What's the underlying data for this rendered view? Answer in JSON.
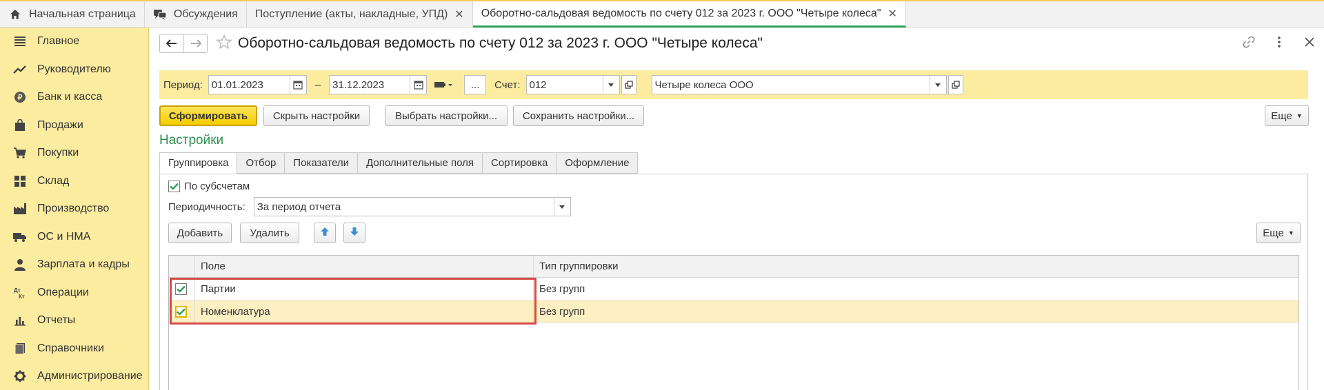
{
  "top_tabs": [
    {
      "label": "Начальная страница",
      "icon": "home-icon"
    },
    {
      "label": "Обсуждения",
      "icon": "chat-icon"
    },
    {
      "label": "Поступление (акты, накладные, УПД)",
      "closable": true
    },
    {
      "label": "Оборотно-сальдовая ведомость по счету 012 за 2023 г. ООО \"Четыре колеса\"",
      "closable": true,
      "active": true
    }
  ],
  "sidebar": {
    "items": [
      {
        "label": "Главное",
        "icon": "menu-icon"
      },
      {
        "label": "Руководителю",
        "icon": "trend-icon"
      },
      {
        "label": "Банк и касса",
        "icon": "coin-icon"
      },
      {
        "label": "Продажи",
        "icon": "bag-icon"
      },
      {
        "label": "Покупки",
        "icon": "cart-icon"
      },
      {
        "label": "Склад",
        "icon": "warehouse-icon"
      },
      {
        "label": "Производство",
        "icon": "factory-icon"
      },
      {
        "label": "ОС и НМА",
        "icon": "truck-icon"
      },
      {
        "label": "Зарплата и кадры",
        "icon": "person-icon"
      },
      {
        "label": "Операции",
        "icon": "dt-kt-icon"
      },
      {
        "label": "Отчеты",
        "icon": "bar-chart-icon"
      },
      {
        "label": "Справочники",
        "icon": "book-icon"
      },
      {
        "label": "Администрирование",
        "icon": "gear-icon"
      }
    ],
    "dt_kt_text": {
      "dt": "Дт",
      "kt": "Кт"
    }
  },
  "header": {
    "title": "Оборотно-сальдовая ведомость по счету 012 за 2023 г. ООО \"Четыре колеса\""
  },
  "period_bar": {
    "period_label": "Период:",
    "date_from": "01.01.2023",
    "dash": "–",
    "date_to": "31.12.2023",
    "more_label": "...",
    "account_label": "Счет:",
    "account_value": "012",
    "organization_value": "Четыре колеса ООО"
  },
  "toolbar": {
    "generate_label": "Сформировать",
    "hide_settings_label": "Скрыть настройки",
    "choose_settings_label": "Выбрать настройки...",
    "save_settings_label": "Сохранить настройки...",
    "more_label": "Еще"
  },
  "settings": {
    "title": "Настройки",
    "tabs": [
      "Группировка",
      "Отбор",
      "Показатели",
      "Дополнительные поля",
      "Сортировка",
      "Оформление"
    ],
    "by_subaccounts_label": "По субсчетам",
    "by_subaccounts_checked": true,
    "periodicity_label": "Периодичность:",
    "periodicity_value": "За период отчета",
    "add_label": "Добавить",
    "delete_label": "Удалить",
    "more_label": "Еще"
  },
  "grid": {
    "columns": [
      "Поле",
      "Тип группировки"
    ],
    "rows": [
      {
        "field": "Партии",
        "type": "Без групп",
        "checked": true,
        "selected": false
      },
      {
        "field": "Номенклатура",
        "type": "Без групп",
        "checked": true,
        "selected": true
      }
    ]
  },
  "colors": {
    "accent_green": "#2f8f53",
    "sidebar_bg": "#fbeca0",
    "primary_button": "#f5cc00",
    "highlight_border": "#d44b4b",
    "arrow_blue": "#3b8fd6"
  }
}
